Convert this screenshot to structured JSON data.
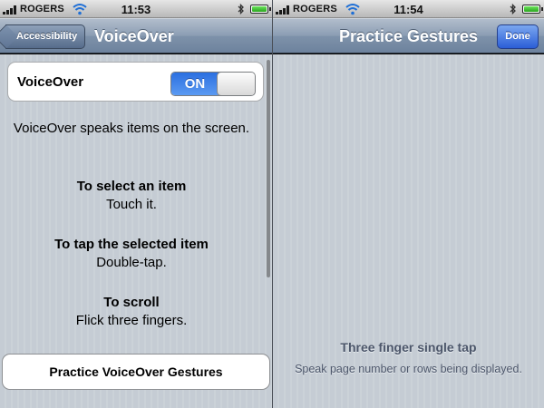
{
  "left_screen": {
    "status": {
      "carrier": "ROGERS",
      "time": "11:53"
    },
    "nav": {
      "back_label": "Accessibility",
      "title": "VoiceOver"
    },
    "voiceover_row": {
      "label": "VoiceOver",
      "switch_state": "ON"
    },
    "description": {
      "intro": "VoiceOver speaks items on the screen.",
      "select_heading": "To select an item",
      "select_text": "Touch it.",
      "tap_heading": "To tap the selected item",
      "tap_text": "Double-tap.",
      "scroll_heading": "To scroll",
      "scroll_text": "Flick three fingers."
    },
    "practice_button": "Practice VoiceOver Gestures"
  },
  "right_screen": {
    "status": {
      "carrier": "ROGERS",
      "time": "11:54"
    },
    "nav": {
      "title": "Practice Gestures",
      "done_label": "Done"
    },
    "gesture": {
      "title": "Three finger single tap",
      "description": "Speak page number or rows being displayed."
    }
  },
  "colors": {
    "nav_bar": "#7e92aa",
    "switch_on": "#2b6fe0",
    "done_button": "#2b5ed6",
    "pinstripe_bg": "#c5ccd4"
  },
  "icons": [
    "signal-bars-icon",
    "wifi-icon",
    "bluetooth-icon",
    "battery-icon"
  ]
}
